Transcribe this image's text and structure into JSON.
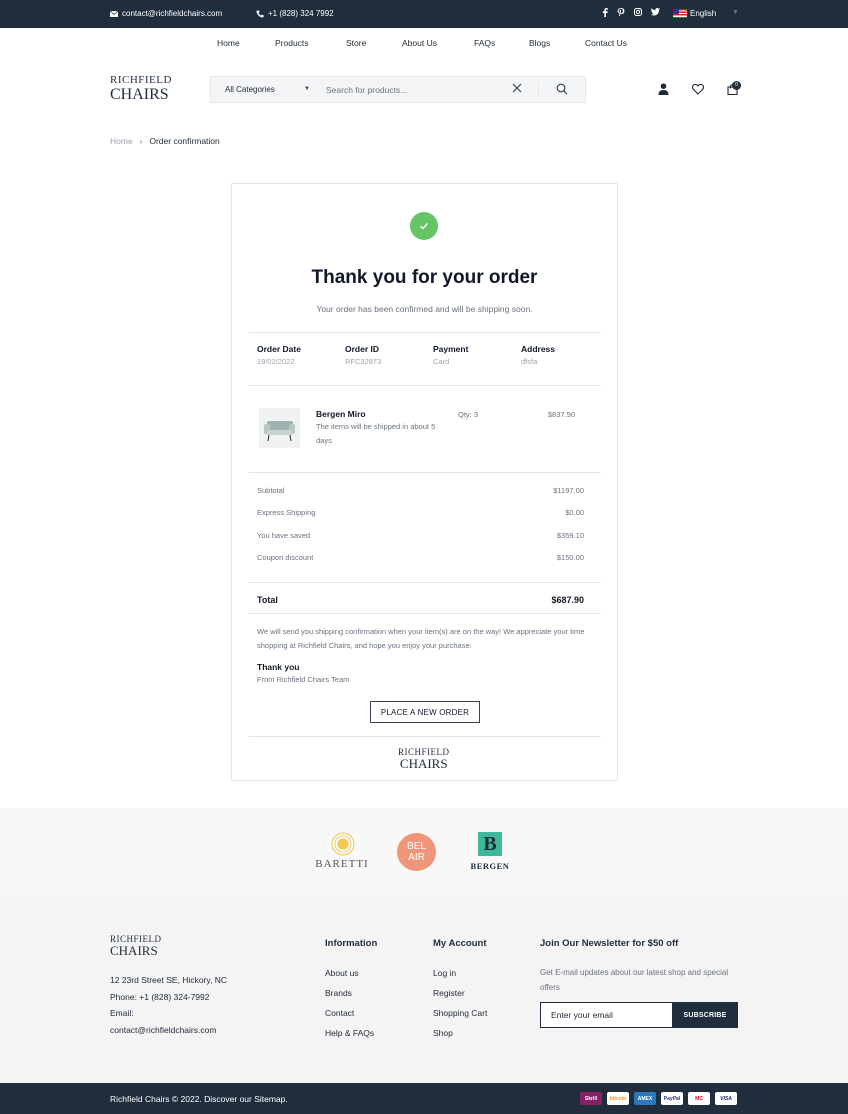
{
  "topbar": {
    "email": "contact@richfieldchairs.com",
    "phone": "+1 (828) 324 7992",
    "language": "English"
  },
  "nav": {
    "items": [
      "Home",
      "Products",
      "Store",
      "About Us",
      "FAQs",
      "Blogs",
      "Contact Us"
    ]
  },
  "brand": {
    "logo_line1": "RICHFIELD",
    "logo_line2": "CHAIRS"
  },
  "search": {
    "category": "All Categories",
    "placeholder": "Search for products..."
  },
  "header": {
    "cart_count": "0"
  },
  "breadcrumb": {
    "home": "Home",
    "current": "Order confirmation"
  },
  "confirmation": {
    "title": "Thank you for your order",
    "subtitle": "Your order has been confirmed and will be shipping soon.",
    "meta": [
      {
        "label": "Order Date",
        "value": "19/02/2022"
      },
      {
        "label": "Order ID",
        "value": "RFC32873"
      },
      {
        "label": "Payment",
        "value": "Card"
      },
      {
        "label": "Address",
        "value": "dfsfa"
      }
    ],
    "item": {
      "name": "Bergen Miro",
      "desc": "The items will be shipped in about 5 days",
      "qty": "Qty: 3",
      "price": "$837.90"
    },
    "summary": [
      {
        "label": "Subtotal",
        "value": "$1197.00"
      },
      {
        "label": "Express Shipping",
        "value": "$0.00"
      },
      {
        "label": "You have saved",
        "value": "$359.10"
      },
      {
        "label": "Coupon discount",
        "value": "$150.00"
      }
    ],
    "total_label": "Total",
    "total_value": "$687.90",
    "note": "We will send you shipping confirmation when your item(s) are on the way! We appreciate your time shopping at Richfield Chairs, and hope you enjoy your purchase.",
    "thanks": "Thank you",
    "from": "From Richfield Chairs Team",
    "button": "PLACE A NEW ORDER"
  },
  "brands": {
    "items": [
      {
        "name": "BARETTI",
        "color": "#f2c94c"
      },
      {
        "name_line1": "BEL",
        "name_line2": "AIR",
        "color": "#f0957a"
      },
      {
        "mark": "B",
        "name": "BERGEN",
        "color": "#3cb99a"
      }
    ]
  },
  "footer": {
    "address": "12 23rd Street SE, Hickory, NC",
    "phone": "Phone: +1 (828) 324-7992",
    "email_label": "Email:",
    "email": "contact@richfieldchairs.com",
    "information": {
      "heading": "Information",
      "links": [
        "About us",
        "Brands",
        "Contact",
        "Help & FAQs"
      ]
    },
    "account": {
      "heading": "My Account",
      "links": [
        "Log in",
        "Register",
        "Shopping Cart",
        "Shop"
      ]
    },
    "newsletter": {
      "heading": "Join Our Newsletter for $50 off",
      "desc": "Get E-mail updates about our latest shop and special offers",
      "placeholder": "Enter your email",
      "button": "SUBSCRIBE"
    },
    "copyright": "Richfield Chairs © 2022. Discover our Sitemap."
  },
  "payments": [
    {
      "name": "Skrill",
      "bg": "#862165",
      "fg": "#ffffff"
    },
    {
      "name": "bitcoin",
      "bg": "#ffffff",
      "fg": "#f7931a"
    },
    {
      "name": "AMEX",
      "bg": "#2e77bb",
      "fg": "#ffffff"
    },
    {
      "name": "PayPal",
      "bg": "#ffffff",
      "fg": "#253b80"
    },
    {
      "name": "MC",
      "bg": "#ffffff",
      "fg": "#eb001b"
    },
    {
      "name": "VISA",
      "bg": "#ffffff",
      "fg": "#1a1f71"
    }
  ],
  "colors": {
    "dark": "#1f2d3d",
    "success": "#65c466"
  }
}
